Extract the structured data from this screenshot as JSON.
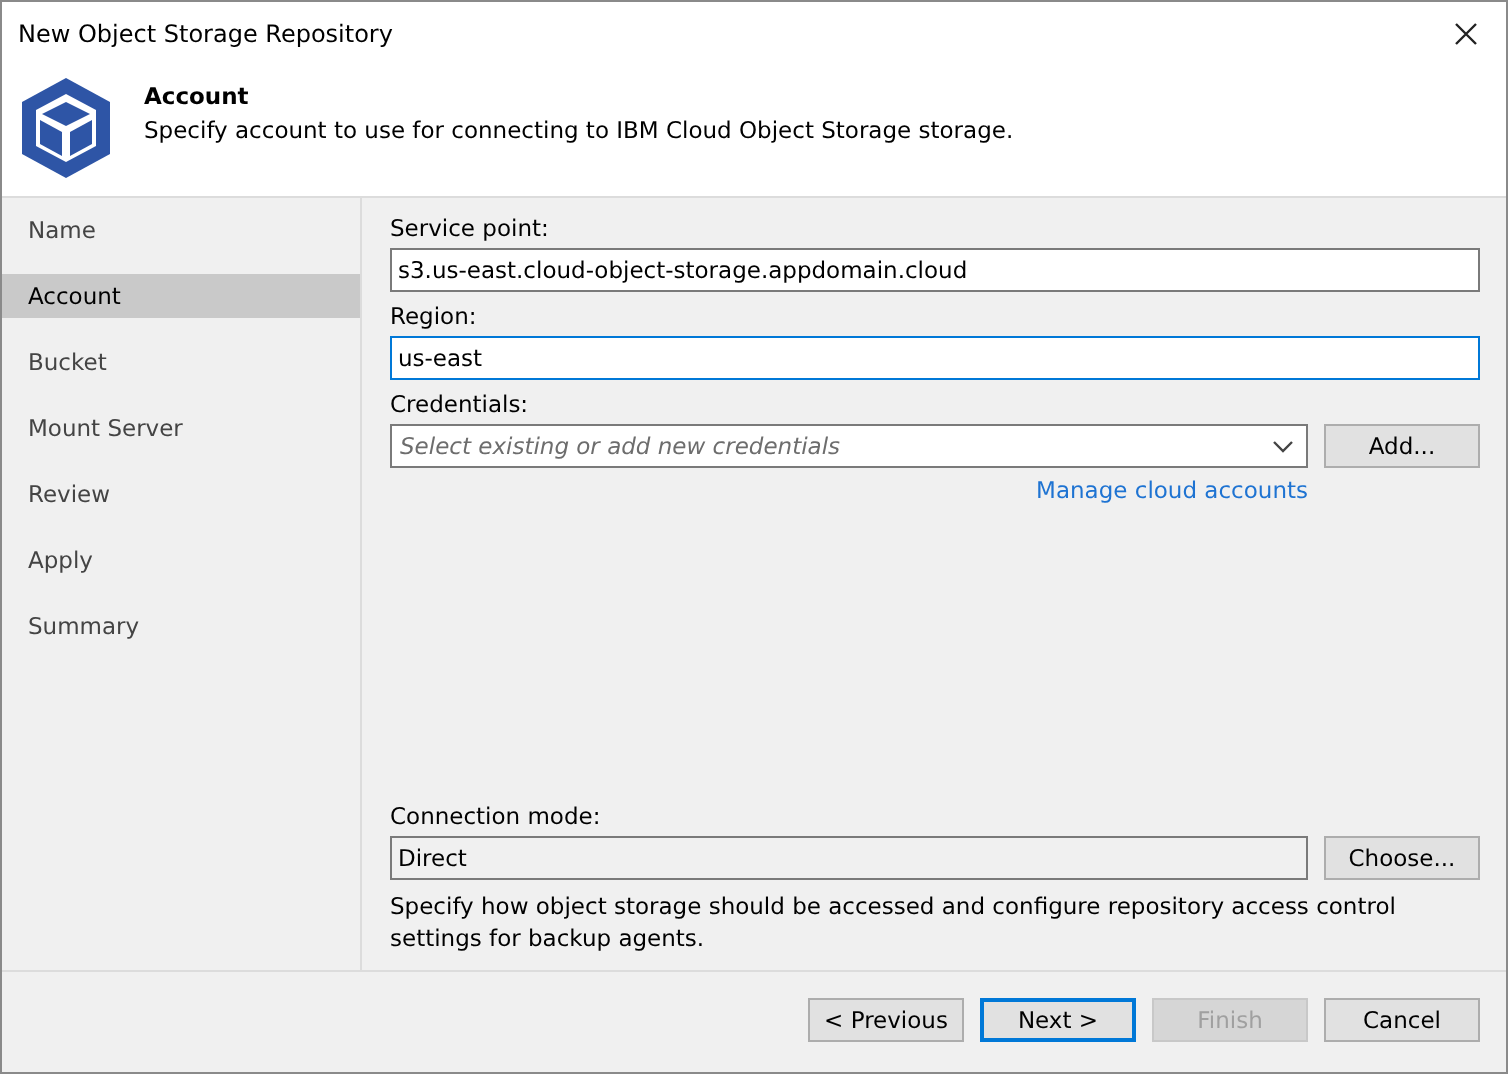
{
  "window": {
    "title": "New Object Storage Repository"
  },
  "header": {
    "title": "Account",
    "description": "Specify account to use for connecting to IBM Cloud Object Storage storage."
  },
  "steps": [
    {
      "label": "Name",
      "selected": false
    },
    {
      "label": "Account",
      "selected": true
    },
    {
      "label": "Bucket",
      "selected": false
    },
    {
      "label": "Mount Server",
      "selected": false
    },
    {
      "label": "Review",
      "selected": false
    },
    {
      "label": "Apply",
      "selected": false
    },
    {
      "label": "Summary",
      "selected": false
    }
  ],
  "service_point": {
    "label": "Service point:",
    "value": "s3.us-east.cloud-object-storage.appdomain.cloud",
    "focused": false
  },
  "region": {
    "label": "Region:",
    "value": "us-east",
    "focused": true
  },
  "credentials": {
    "label": "Credentials:",
    "placeholder": "Select existing or add new credentials",
    "button": "Add...",
    "link": "Manage cloud accounts"
  },
  "connection_mode": {
    "label": "Connection mode:",
    "value": "Direct",
    "button": "Choose...",
    "description": "Specify how object storage should be accessed and configure repository access control settings for backup agents."
  },
  "buttons": [
    {
      "label": "< Previous",
      "disabled": false,
      "focused": false
    },
    {
      "label": "Next >",
      "disabled": false,
      "focused": true
    },
    {
      "label": "Finish",
      "disabled": true,
      "focused": false
    },
    {
      "label": "Cancel",
      "disabled": false,
      "focused": false
    }
  ]
}
